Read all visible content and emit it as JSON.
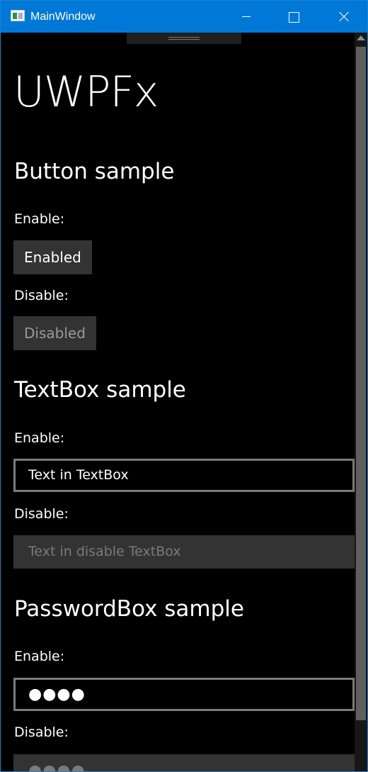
{
  "window": {
    "title": "MainWindow"
  },
  "app": {
    "title": "UWPFx"
  },
  "buttons": {
    "section_title": "Button sample",
    "enable_label": "Enable:",
    "enabled_button": "Enabled",
    "disable_label": "Disable:",
    "disabled_button": "Disabled"
  },
  "textbox": {
    "section_title": "TextBox sample",
    "enable_label": "Enable:",
    "enabled_value": "Text in TextBox",
    "disable_label": "Disable:",
    "disabled_value": "Text in disable TextBox"
  },
  "passwordbox": {
    "section_title": "PasswordBox sample",
    "enable_label": "Enable:",
    "enabled_value": "●●●●",
    "disable_label": "Disable:",
    "disabled_value": "●●●●"
  },
  "icons": {
    "app": "app-window-icon",
    "minimize": "minimize-icon",
    "maximize": "maximize-icon",
    "close": "close-icon",
    "scroll_up": "chevron-up-icon"
  },
  "colors": {
    "titlebar": "#0078d7",
    "background": "#000000",
    "control": "#333333",
    "border": "#7a7a7a"
  }
}
